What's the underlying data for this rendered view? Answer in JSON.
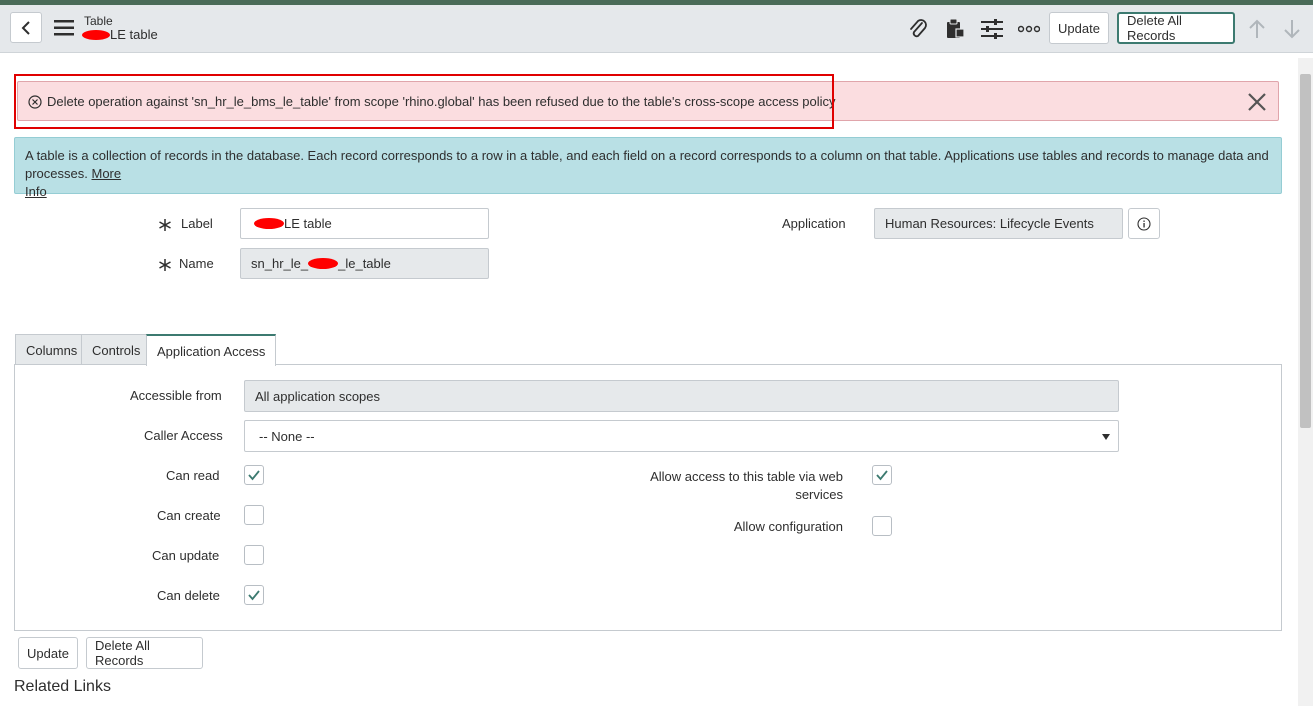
{
  "header": {
    "title": "Table",
    "subtitle_suffix": "LE table",
    "update_label": "Update",
    "delete_all_label": "Delete All Records"
  },
  "error": {
    "message": "Delete operation against 'sn_hr_le_bms_le_table' from scope 'rhino.global' has been refused due to the table's cross-scope access policy"
  },
  "info": {
    "text": "A table is a collection of records in the database. Each record corresponds to a row in a table, and each field on a record corresponds to a column on that table. Applications use tables and records to manage data and processes.",
    "link_more": "More",
    "link_info": "Info"
  },
  "form": {
    "label_label": "Label",
    "label_value_suffix": "LE table",
    "name_label": "Name",
    "name_value_prefix": "sn_hr_le_",
    "name_value_suffix": "_le_table",
    "application_label": "Application",
    "application_value": "Human Resources: Lifecycle Events"
  },
  "tabs": [
    {
      "label": "Columns"
    },
    {
      "label": "Controls"
    },
    {
      "label": "Application Access"
    }
  ],
  "access": {
    "accessible_from_label": "Accessible from",
    "accessible_from_value": "All application scopes",
    "caller_access_label": "Caller Access",
    "caller_access_value": "-- None --",
    "can_read_label": "Can read",
    "can_read": true,
    "can_create_label": "Can create",
    "can_create": false,
    "can_update_label": "Can update",
    "can_update": false,
    "can_delete_label": "Can delete",
    "can_delete": true,
    "web_services_label_1": "Allow access to this table via web",
    "web_services_label_2": "services",
    "web_services": true,
    "allow_config_label": "Allow configuration",
    "allow_config": false
  },
  "footer": {
    "update_label": "Update",
    "delete_all_label": "Delete All Records",
    "related_links": "Related Links"
  },
  "colors": {
    "accent": "#3c7a70",
    "error_bg": "#fbdde0",
    "info_bg": "#b9e0e5",
    "highlight": "#e00000"
  },
  "icons": [
    "back-icon",
    "menu-icon",
    "paperclip-icon",
    "clipboard-icon",
    "sliders-icon",
    "more-icon",
    "arrow-up-icon",
    "arrow-down-icon",
    "error-circle-icon",
    "close-icon",
    "info-icon",
    "required-icon",
    "checkmark-icon",
    "dropdown-caret-icon"
  ]
}
